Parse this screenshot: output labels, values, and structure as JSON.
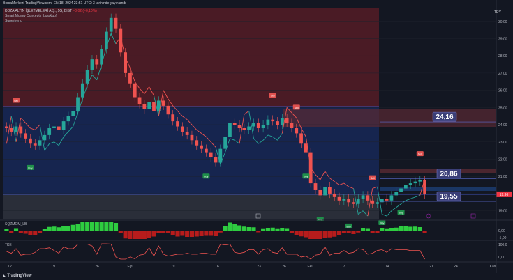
{
  "header": {
    "caption": "BorsaMerkezi TradingView.com, Eki 18, 2024 23:51 UTC+3 tarihinde yayınlandı"
  },
  "legend": {
    "symbol": "KOZA ALTIN İŞLETMELERİ A.Ş., 1G, BIST",
    "change": "−0,02 (−0,10%)",
    "indicators": [
      "Smart Money Concepts [LuxAlgo]",
      "Supertrend"
    ]
  },
  "currency": "TRY",
  "brand": "TradingView",
  "colors": {
    "bull": "#26a69a",
    "bear": "#ef5350",
    "premium_zone": "#4a1b25",
    "discount_zone": "#16254f",
    "eq_zone": "#2a2e39",
    "label_bg": "#3b3f78",
    "price_tag": "#f23645",
    "buy_tag": "#1f8f4a",
    "sell_tag": "#e0514f"
  },
  "chart_data": [
    {
      "type": "candlestick",
      "title": "KOZA ALTIN İŞLETMELERİ A.Ş., 1G, BIST",
      "ylim": [
        18.5,
        30.8
      ],
      "y_ticks": [
        "30,00",
        "29,00",
        "28,00",
        "27,00",
        "26,00",
        "25,00",
        "24,00",
        "23,00",
        "22,00",
        "21,00",
        "20,00",
        "19,00"
      ],
      "x_ticks": [
        "12",
        "19",
        "26",
        "Eyl",
        "9",
        "16",
        "23",
        "26",
        "Eki",
        "7",
        "14",
        "21",
        "24",
        "Kas"
      ],
      "close": [
        23.8,
        23.6,
        23.9,
        23.5,
        23.2,
        22.9,
        22.8,
        23.1,
        23.4,
        23.8,
        23.9,
        23.7,
        24.2,
        24.5,
        24.8,
        25.6,
        26.4,
        27.2,
        27.8,
        27.5,
        28.4,
        29.4,
        30.2,
        29.6,
        28.2,
        27.0,
        26.4,
        25.6,
        25.2,
        24.9,
        25.3,
        24.8,
        25.4,
        25.1,
        24.6,
        24.2,
        23.9,
        23.6,
        23.4,
        23.1,
        22.8,
        22.6,
        22.4,
        22.1,
        21.8,
        22.6,
        23.3,
        24.1,
        24.0,
        23.8,
        23.7,
        23.9,
        24.1,
        23.8,
        24.0,
        24.3,
        24.2,
        24.0,
        24.4,
        24.1,
        23.8,
        23.5,
        22.9,
        22.4,
        20.6,
        20.2,
        19.9,
        20.4,
        20.0,
        19.8,
        19.6,
        19.7,
        19.5,
        19.4,
        19.7,
        19.9,
        19.6,
        19.4,
        19.5,
        19.7,
        19.6,
        19.9,
        20.1,
        20.3,
        20.5,
        20.6,
        20.7,
        20.8,
        19.96
      ],
      "last_price": "19,96",
      "levels": [
        {
          "label": "24,16",
          "value": 24.16
        },
        {
          "label": "20,86",
          "value": 20.86
        },
        {
          "label": "19,55",
          "value": 19.55
        }
      ],
      "signals": [
        {
          "label": "Buy",
          "index": 5
        },
        {
          "label": "Sell",
          "index": 2
        },
        {
          "label": "Sell",
          "index": 22
        },
        {
          "label": "Buy",
          "index": 42
        },
        {
          "label": "Sell",
          "index": 56
        },
        {
          "label": "Buy",
          "index": 63
        },
        {
          "label": "Sell",
          "index": 61
        },
        {
          "label": "Buy",
          "index": 66
        },
        {
          "label": "Buy",
          "index": 72
        },
        {
          "label": "Buy",
          "index": 79
        },
        {
          "label": "Sell",
          "index": 77
        },
        {
          "label": "Sell",
          "index": 87
        },
        {
          "label": "Buy",
          "index": 83
        }
      ],
      "zones": [
        "premium",
        "equilibrium",
        "discount"
      ]
    },
    {
      "type": "bar",
      "title": "SQZMOM_LB",
      "y_ticks": [
        "0,00",
        "-5,00"
      ]
    },
    {
      "type": "line",
      "title": "TKE",
      "y_ticks": [
        "100,0",
        "0,00"
      ]
    }
  ]
}
